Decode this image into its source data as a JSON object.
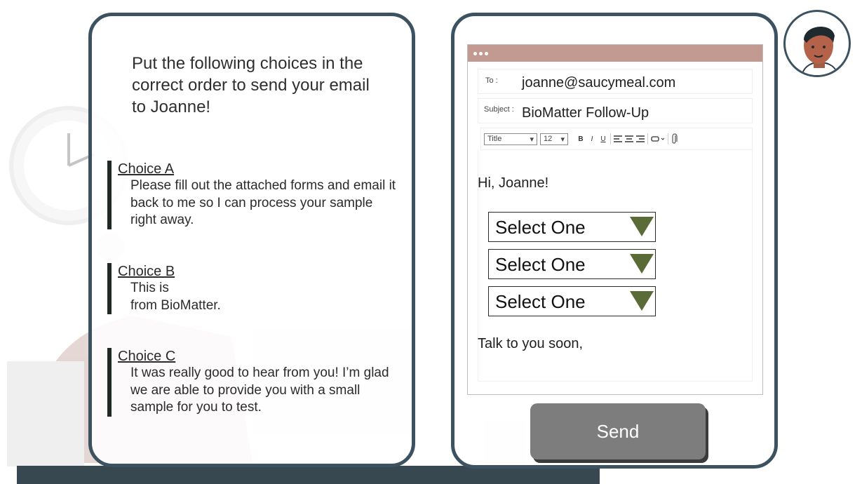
{
  "instructions": "Put the following choices in the correct order to send your email to Joanne!",
  "choices": [
    {
      "title": "Choice A",
      "text": "Please fill out the attached forms and email it back to me so I can process your sample right away."
    },
    {
      "title": "Choice B",
      "text_line1": "This is",
      "text_line2": "from BioMatter."
    },
    {
      "title": "Choice C",
      "text": "It was really good to hear from you! I’m glad we are able to provide you with a small sample for you to test."
    }
  ],
  "email": {
    "to_label": "To :",
    "to_value": "joanne@saucymeal.com",
    "subject_label": "Subject :",
    "subject_value": "BioMatter Follow-Up",
    "toolbar": {
      "style_select": "Title",
      "size_select": "12",
      "bold": "B",
      "italic": "I",
      "underline": "U"
    },
    "greeting": "Hi, Joanne!",
    "dropdowns": [
      "Select One",
      "Select One",
      "Select One"
    ],
    "closing": "Talk to you soon,"
  },
  "send_label": "Send",
  "colors": {
    "panel_border": "#3c5260",
    "title_bar": "#c29a91",
    "dropdown_arrow": "#5a6b38",
    "send_button": "#7d7d7d"
  }
}
